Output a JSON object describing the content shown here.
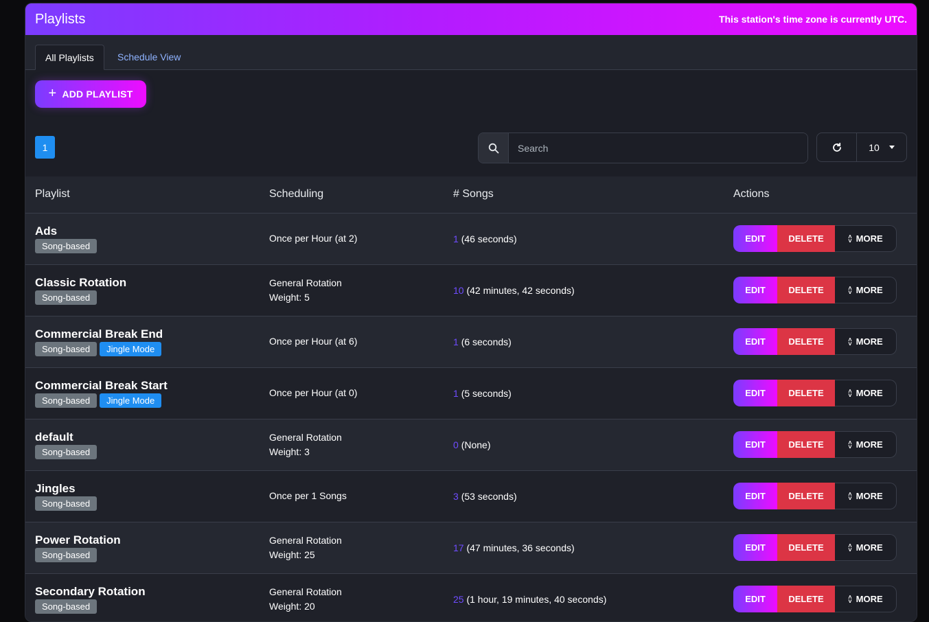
{
  "header": {
    "title": "Playlists",
    "timezone_note": "This station's time zone is currently UTC."
  },
  "tabs": [
    {
      "label": "All Playlists",
      "active": true
    },
    {
      "label": "Schedule View",
      "active": false
    }
  ],
  "add_button": {
    "label": "ADD PLAYLIST"
  },
  "pagination": {
    "current_page": "1"
  },
  "search": {
    "placeholder": "Search",
    "value": ""
  },
  "per_page": {
    "value": "10"
  },
  "table": {
    "columns": [
      "Playlist",
      "Scheduling",
      "# Songs",
      "Actions"
    ],
    "rows": [
      {
        "name": "Ads",
        "badges": [
          "Song-based"
        ],
        "sched1": "Once per Hour (at 2)",
        "sched2": "",
        "count": "1",
        "duration": "(46 seconds)"
      },
      {
        "name": "Classic Rotation",
        "badges": [
          "Song-based"
        ],
        "sched1": "General Rotation",
        "sched2": "Weight: 5",
        "count": "10",
        "duration": "(42 minutes, 42 seconds)"
      },
      {
        "name": "Commercial Break End",
        "badges": [
          "Song-based",
          "Jingle Mode"
        ],
        "sched1": "Once per Hour (at 6)",
        "sched2": "",
        "count": "1",
        "duration": "(6 seconds)"
      },
      {
        "name": "Commercial Break Start",
        "badges": [
          "Song-based",
          "Jingle Mode"
        ],
        "sched1": "Once per Hour (at 0)",
        "sched2": "",
        "count": "1",
        "duration": "(5 seconds)"
      },
      {
        "name": "default",
        "badges": [
          "Song-based"
        ],
        "sched1": "General Rotation",
        "sched2": "Weight: 3",
        "count": "0",
        "duration": "(None)"
      },
      {
        "name": "Jingles",
        "badges": [
          "Song-based"
        ],
        "sched1": "Once per 1 Songs",
        "sched2": "",
        "count": "3",
        "duration": "(53 seconds)"
      },
      {
        "name": "Power Rotation",
        "badges": [
          "Song-based"
        ],
        "sched1": "General Rotation",
        "sched2": "Weight: 25",
        "count": "17",
        "duration": "(47 minutes, 36 seconds)"
      },
      {
        "name": "Secondary Rotation",
        "badges": [
          "Song-based"
        ],
        "sched1": "General Rotation",
        "sched2": "Weight: 20",
        "count": "25",
        "duration": "(1 hour, 19 minutes, 40 seconds)"
      }
    ]
  },
  "actions": {
    "edit": "EDIT",
    "delete": "DELETE",
    "more": "MORE"
  },
  "colors": {
    "accent_start": "#7b3cff",
    "accent_end": "#ee0cff",
    "danger": "#dc3545",
    "info": "#1f8ef1",
    "badge_gray": "#6c757d"
  }
}
